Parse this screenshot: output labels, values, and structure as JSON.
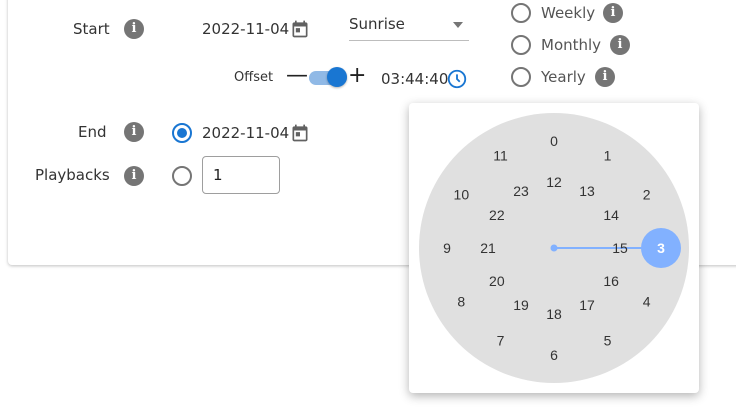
{
  "start": {
    "label": "Start",
    "date": "2022-11-04",
    "select_value": "Sunrise",
    "offset_label": "Offset",
    "offset_time": "03:44:40"
  },
  "end": {
    "label": "End",
    "date": "2022-11-04"
  },
  "playbacks": {
    "label": "Playbacks",
    "value": "1"
  },
  "recurrence": [
    "Weekly",
    "Monthly",
    "Yearly"
  ],
  "clock": {
    "outer": [
      "0",
      "1",
      "2",
      "3",
      "4",
      "5",
      "6",
      "7",
      "8",
      "9",
      "10",
      "11"
    ],
    "inner": [
      "12",
      "13",
      "14",
      "15",
      "16",
      "17",
      "18",
      "19",
      "20",
      "21",
      "22",
      "23"
    ],
    "selected": "3",
    "accent": "#82b1ff"
  },
  "icons": {
    "info": "info-icon",
    "calendar": "calendar-icon",
    "clock": "clock-icon",
    "minus": "minus-icon",
    "plus": "plus-icon"
  },
  "colors": {
    "primary": "#1976d2",
    "info_bg": "#757575",
    "dial_bg": "#e0e0e0"
  }
}
